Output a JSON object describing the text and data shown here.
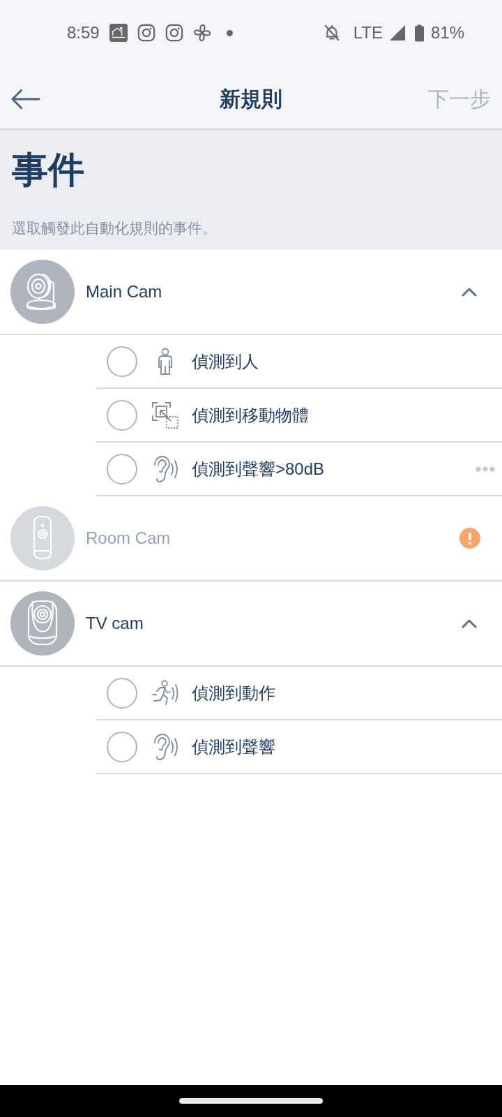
{
  "status_bar": {
    "time": "8:59",
    "network": "LTE",
    "battery": "81%"
  },
  "header": {
    "title": "新規則",
    "next_label": "下一步"
  },
  "intro": {
    "title": "事件",
    "description": "選取觸發此自動化規則的事件。"
  },
  "devices": [
    {
      "name": "Main Cam",
      "kind": "pan",
      "disabled": false,
      "warning": false,
      "expanded": true,
      "events": [
        {
          "label": "偵測到人",
          "kind": "person",
          "selected": false,
          "more": false
        },
        {
          "label": "偵測到移動物體",
          "kind": "object",
          "selected": false,
          "more": false
        },
        {
          "label": "偵測到聲響>80dB",
          "kind": "sound",
          "selected": false,
          "more": true
        }
      ]
    },
    {
      "name": "Room Cam",
      "kind": "slim",
      "disabled": true,
      "warning": true
    },
    {
      "name": "TV cam",
      "kind": "cube",
      "disabled": false,
      "warning": false,
      "expanded": true,
      "events": [
        {
          "label": "偵測到動作",
          "kind": "motion",
          "selected": false,
          "more": false
        },
        {
          "label": "偵測到聲響",
          "kind": "sound",
          "selected": false,
          "more": false
        }
      ]
    }
  ]
}
